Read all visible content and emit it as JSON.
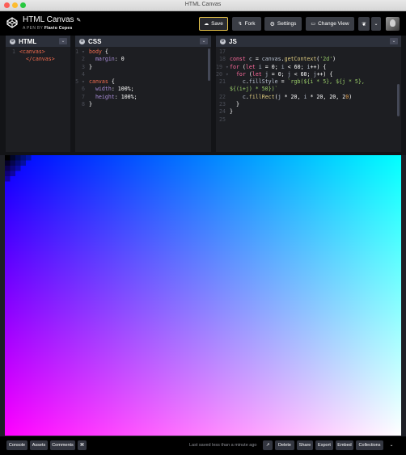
{
  "window": {
    "title": "HTML Canvas"
  },
  "header": {
    "pen_title": "HTML Canvas",
    "byline_prefix": "A PEN BY",
    "author": "Flavio Copes",
    "save_label": "Save",
    "fork_label": "Fork",
    "settings_label": "Settings",
    "change_view_label": "Change View"
  },
  "panels": {
    "html": {
      "name": "HTML",
      "lines": [
        {
          "n": "1",
          "html": "<span class=\"t\">&lt;canvas&gt;</span>"
        },
        {
          "n": "",
          "html": "  <span class=\"t\">&lt;/canvas&gt;</span>"
        }
      ]
    },
    "css": {
      "name": "CSS",
      "lines": [
        {
          "n": "1 ▾",
          "html": "<span class=\"t\">body</span> <span class=\"tx\">{</span>"
        },
        {
          "n": "2",
          "html": "  <span class=\"p\">margin</span><span class=\"tx\">: </span><span class=\"n\">0</span>"
        },
        {
          "n": "3",
          "html": "<span class=\"tx\">}</span>"
        },
        {
          "n": "4",
          "html": ""
        },
        {
          "n": "5 ▾",
          "html": "<span class=\"t\">canvas</span> <span class=\"tx\">{</span>"
        },
        {
          "n": "6",
          "html": "  <span class=\"p\">width</span><span class=\"tx\">: </span><span class=\"n\">100%</span><span class=\"tx\">;</span>"
        },
        {
          "n": "7",
          "html": "  <span class=\"p\">height</span><span class=\"tx\">: </span><span class=\"n\">100%</span><span class=\"tx\">;</span>"
        },
        {
          "n": "8",
          "html": "<span class=\"tx\">}</span>"
        }
      ]
    },
    "js": {
      "name": "JS",
      "lines": [
        {
          "n": "17",
          "html": ""
        },
        {
          "n": "18",
          "html": "<span class=\"k\">const</span> <span class=\"v\">c</span> <span class=\"tx\">=</span> <span class=\"v\">canvas</span><span class=\"tx\">.</span><span class=\"fn\">getContext</span><span class=\"tx\">(</span><span class=\"s\">'2d'</span><span class=\"tx\">)</span>"
        },
        {
          "n": "19 ▾",
          "html": "<span class=\"k\">for</span> <span class=\"tx\">(</span><span class=\"k\">let</span> <span class=\"v\">i</span> <span class=\"tx\">=</span> <span class=\"n\">0</span><span class=\"tx\">;</span> <span class=\"v\">i</span> <span class=\"tx\">&lt;</span> <span class=\"n\">60</span><span class=\"tx\">;</span> <span class=\"v\">i</span><span class=\"tx\">++) {</span>"
        },
        {
          "n": "20 ▾",
          "html": "  <span class=\"k\">for</span> <span class=\"tx\">(</span><span class=\"k\">let</span> <span class=\"v\">j</span> <span class=\"tx\">=</span> <span class=\"n\">0</span><span class=\"tx\">;</span> <span class=\"v\">j</span> <span class=\"tx\">&lt;</span> <span class=\"n\">60</span><span class=\"tx\">;</span> <span class=\"v\">j</span><span class=\"tx\">++) {</span>"
        },
        {
          "n": "21",
          "html": "    <span class=\"v\">c</span><span class=\"tx\">.</span><span class=\"v\">fillStyle</span> <span class=\"tx\">=</span> <span class=\"s\">`rgb(${i * 5}, ${j * 5},</span>"
        },
        {
          "n": "",
          "html": "<span class=\"s\">${(i+j) * 50})`</span>"
        },
        {
          "n": "22",
          "html": "    <span class=\"v\">c</span><span class=\"tx\">.</span><span class=\"fn\">fillRect</span><span class=\"tx\">(</span><span class=\"v\">j</span> <span class=\"tx\">*</span> <span class=\"n\">20</span><span class=\"tx\">,</span> <span class=\"v\">i</span> <span class=\"tx\">*</span> <span class=\"n\">20</span><span class=\"tx\">,</span> <span class=\"n\">20</span><span class=\"tx\">,</span> <span class=\"n\">2</span><span class=\"sel\">0</span><span class=\"tx\">)</span>"
        },
        {
          "n": "23",
          "html": "  <span class=\"tx\">}</span>"
        },
        {
          "n": "24",
          "html": "<span class=\"tx\">}</span>"
        },
        {
          "n": "25",
          "html": ""
        }
      ]
    }
  },
  "footer": {
    "console": "Console",
    "assets": "Assets",
    "comments": "Comments",
    "status": "Last saved less than a minute ago",
    "delete": "Delete",
    "share": "Share",
    "export": "Export",
    "embed": "Embed",
    "collections": "Collections"
  },
  "colors": {
    "save_border": "#e7c44a",
    "header_bg": "#000000",
    "editor_bg": "#1d1e22"
  }
}
